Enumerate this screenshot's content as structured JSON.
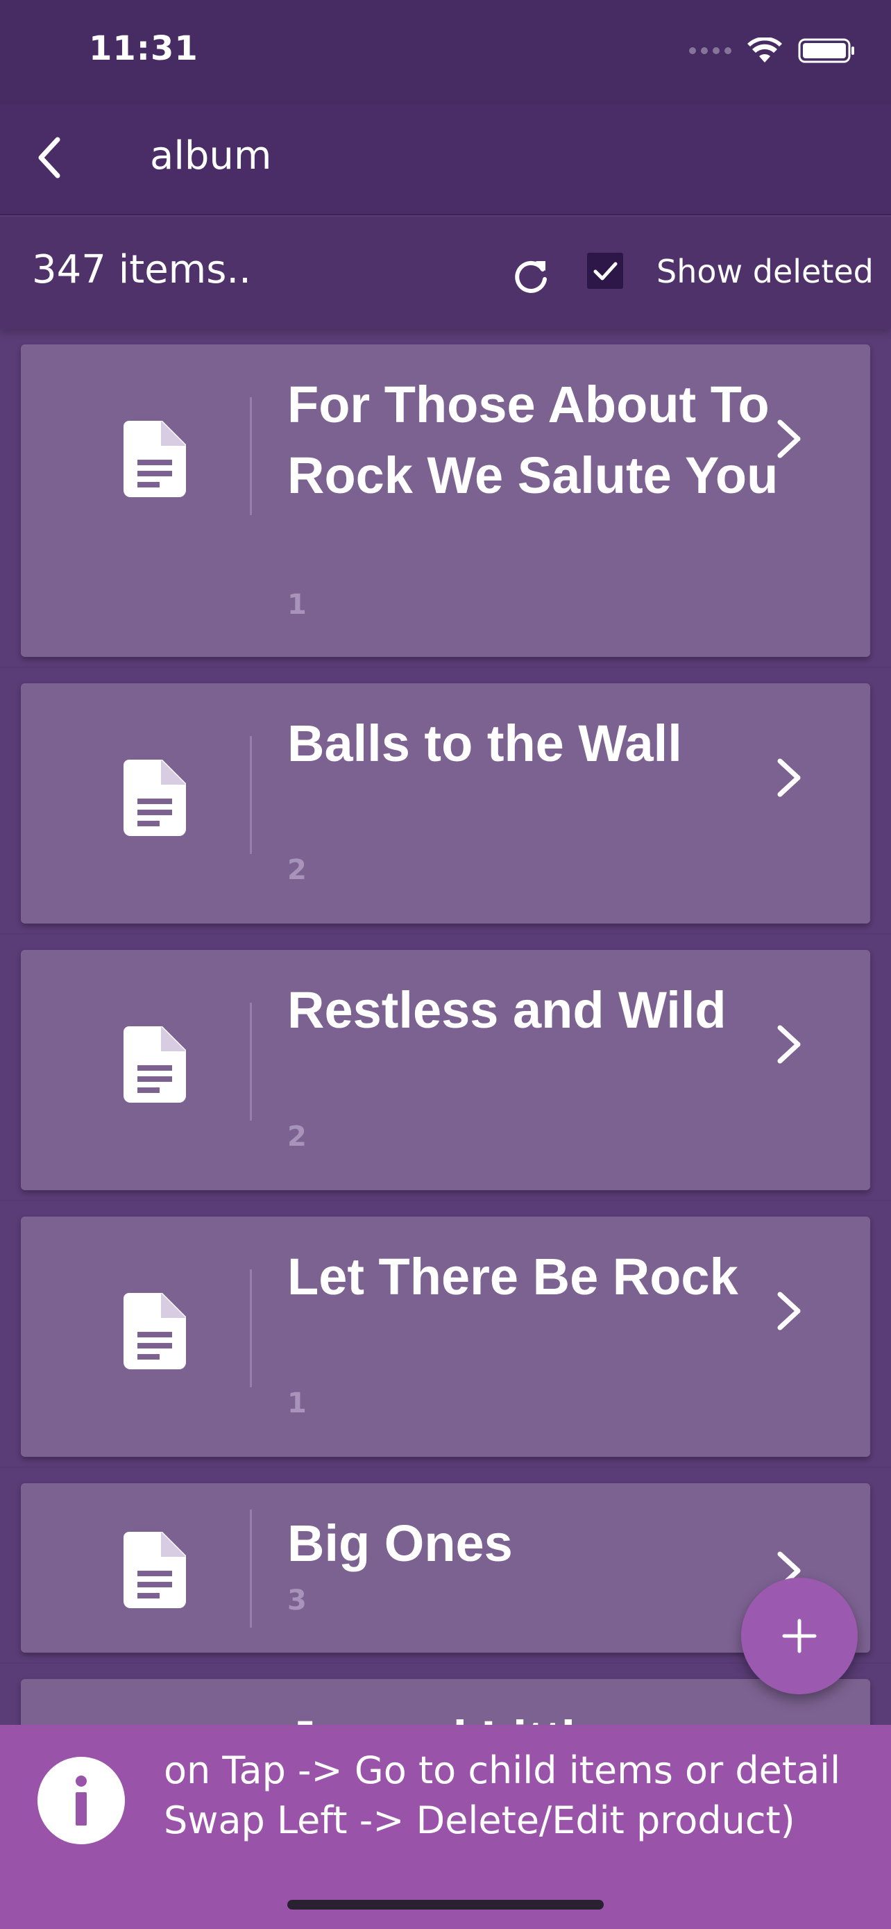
{
  "status_bar": {
    "time": "11:31"
  },
  "header": {
    "title": "album"
  },
  "toolbar": {
    "count_text": "347 items..",
    "show_deleted_label": "Show deleted",
    "show_deleted_checked": true
  },
  "items": [
    {
      "title": "For Those About To Rock We Salute You",
      "sub": "1"
    },
    {
      "title": "Balls to the Wall",
      "sub": "2"
    },
    {
      "title": "Restless and Wild",
      "sub": "2"
    },
    {
      "title": "Let There Be Rock",
      "sub": "1"
    },
    {
      "title": "Big Ones",
      "sub": "3"
    },
    {
      "title": "Jagged Little",
      "sub": ""
    }
  ],
  "banner": {
    "line1": "on Tap -> Go to child items or detail",
    "line2": "Swap Left -> Delete/Edit product)"
  },
  "icons": {
    "back": "chevron-left-icon",
    "refresh": "refresh-icon",
    "check": "check-icon",
    "doc": "document-icon",
    "chevron": "chevron-right-icon",
    "add": "plus-icon",
    "info": "info-icon"
  },
  "colors": {
    "background": "#5a3c76",
    "card": "#7c6291",
    "fab": "#9b59b0",
    "banner": "#9954a9"
  }
}
